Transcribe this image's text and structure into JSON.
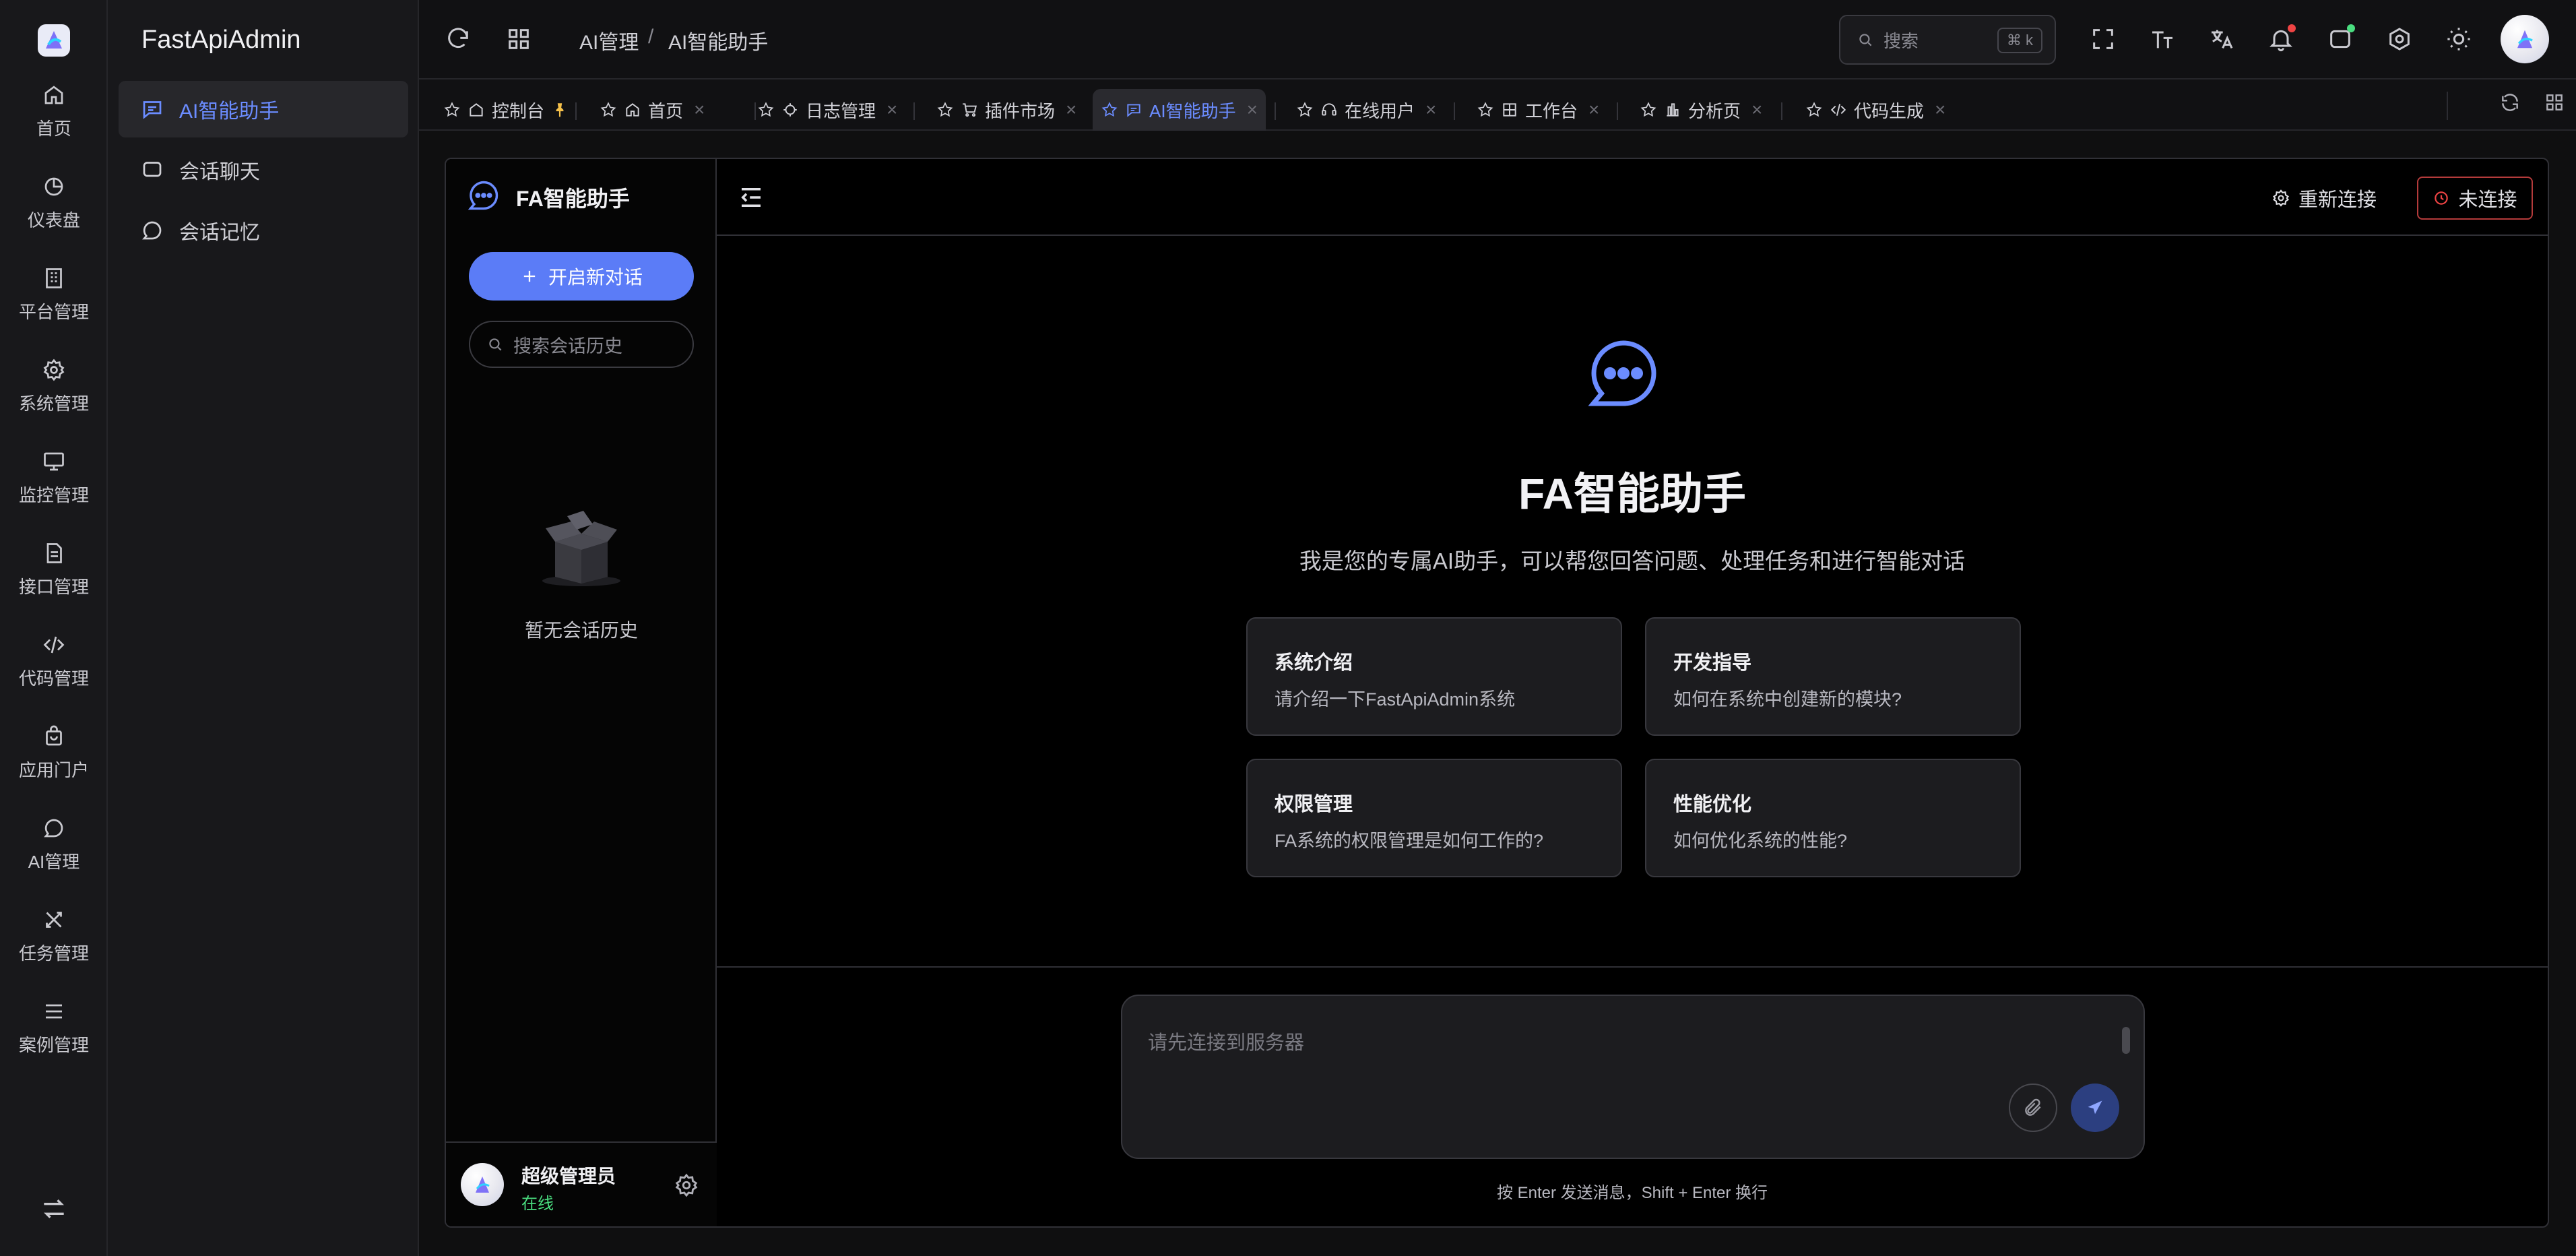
{
  "app": {
    "brand": "FastApiAdmin",
    "colors": {
      "accent": "#5b7cf7",
      "accent_text": "#6b8cff",
      "online": "#4ade80",
      "danger": "#ef4444"
    }
  },
  "rail": {
    "items": [
      {
        "label": "首页",
        "icon": "home-icon"
      },
      {
        "label": "仪表盘",
        "icon": "dashboard-icon"
      },
      {
        "label": "平台管理",
        "icon": "building-icon"
      },
      {
        "label": "系统管理",
        "icon": "gear-icon"
      },
      {
        "label": "监控管理",
        "icon": "monitor-icon"
      },
      {
        "label": "接口管理",
        "icon": "document-icon"
      },
      {
        "label": "代码管理",
        "icon": "code-icon"
      },
      {
        "label": "应用门户",
        "icon": "shopping-bag-icon"
      },
      {
        "label": "AI管理",
        "icon": "chat-bubble-icon"
      },
      {
        "label": "任务管理",
        "icon": "tools-icon"
      },
      {
        "label": "案例管理",
        "icon": "list-icon"
      }
    ]
  },
  "menu": {
    "items": [
      {
        "label": "AI智能助手",
        "active": true
      },
      {
        "label": "会话聊天",
        "active": false
      },
      {
        "label": "会话记忆",
        "active": false
      }
    ]
  },
  "header": {
    "breadcrumb": [
      "AI管理",
      "/",
      "AI智能助手"
    ],
    "search_placeholder": "搜索",
    "search_shortcut": "⌘ k"
  },
  "tabs": [
    {
      "label": "控制台",
      "icon": "home-icon",
      "pinned": true
    },
    {
      "label": "首页",
      "icon": "home-icon"
    },
    {
      "label": "日志管理",
      "icon": "log-icon"
    },
    {
      "label": "插件市场",
      "icon": "cart-icon"
    },
    {
      "label": "AI智能助手",
      "icon": "chat-icon",
      "active": true
    },
    {
      "label": "在线用户",
      "icon": "headset-icon"
    },
    {
      "label": "工作台",
      "icon": "grid-icon"
    },
    {
      "label": "分析页",
      "icon": "chart-icon"
    },
    {
      "label": "代码生成",
      "icon": "code-icon"
    }
  ],
  "sessions": {
    "title": "FA智能助手",
    "new_chat": "开启新对话",
    "search_placeholder": "搜索会话历史",
    "empty": "暂无会话历史"
  },
  "user": {
    "name": "超级管理员",
    "status": "在线"
  },
  "chat": {
    "reconnect": "重新连接",
    "connection_status": "未连接",
    "hero_title": "FA智能助手",
    "hero_subtitle": "我是您的专属AI助手，可以帮您回答问题、处理任务和进行智能对话",
    "cards": [
      {
        "title": "系统介绍",
        "desc": "请介绍一下FastApiAdmin系统"
      },
      {
        "title": "开发指导",
        "desc": "如何在系统中创建新的模块?"
      },
      {
        "title": "权限管理",
        "desc": "FA系统的权限管理是如何工作的?"
      },
      {
        "title": "性能优化",
        "desc": "如何优化系统的性能?"
      }
    ],
    "input_placeholder": "请先连接到服务器",
    "hint": "按 Enter 发送消息，Shift + Enter 换行"
  }
}
